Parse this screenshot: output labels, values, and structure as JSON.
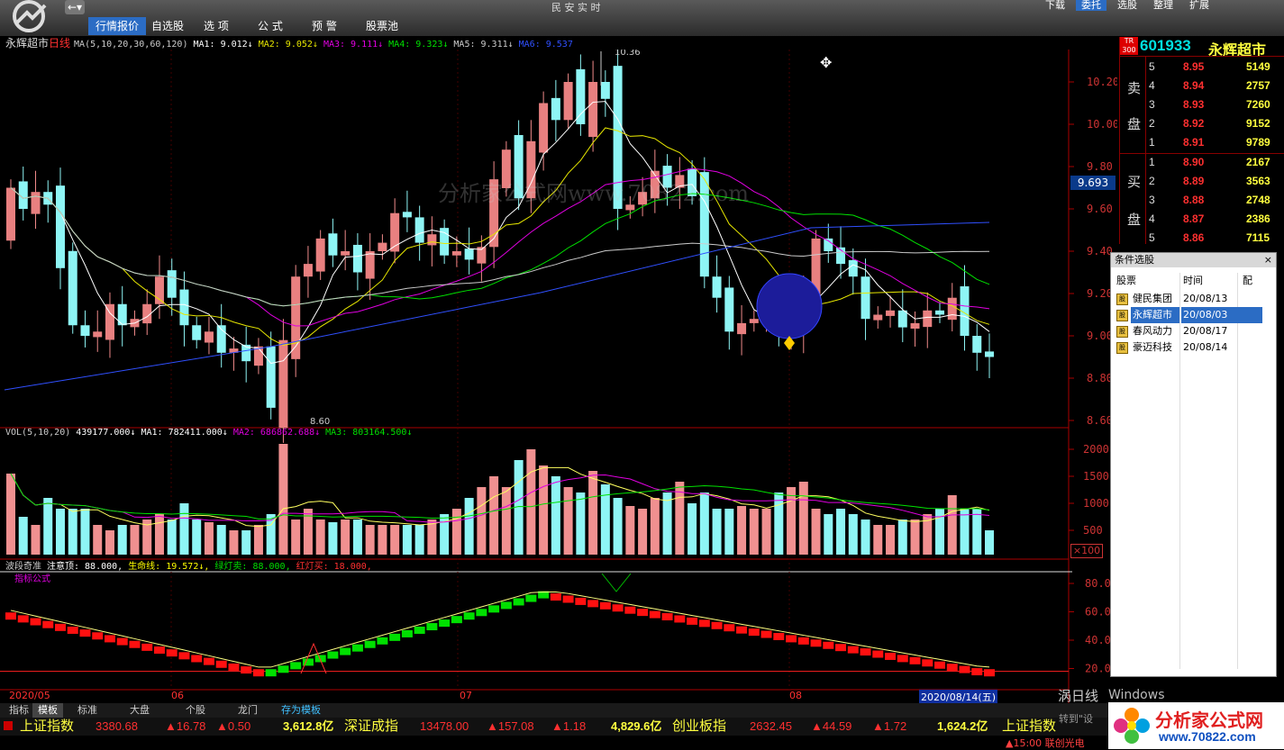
{
  "window": {
    "title": "民 安 实 时"
  },
  "toolbar": {
    "menus": [
      "行情报价",
      "自选股",
      "选 项",
      "公 式",
      "预 警",
      "股票池"
    ],
    "right_buttons": [
      "下载",
      "委托",
      "选股",
      "整理",
      "扩展"
    ]
  },
  "main_chart": {
    "stock_name": "永辉超市",
    "period": "日线",
    "ma_legend": [
      {
        "text": "MA(5,10,20,30,60,120)",
        "color": "#cccccc"
      },
      {
        "text": "MA1: 9.012↓",
        "color": "#ffffff"
      },
      {
        "text": "MA2: 9.052↓",
        "color": "#e6e600"
      },
      {
        "text": "MA3: 9.111↓",
        "color": "#e000e0"
      },
      {
        "text": "MA4: 9.323↓",
        "color": "#00e000"
      },
      {
        "text": "MA5: 9.311↓",
        "color": "#cccccc"
      },
      {
        "text": "MA6: 9.537",
        "color": "#3050ff"
      }
    ],
    "high_label": "10.36",
    "low_label": "8.60",
    "current_price_tag": "9.693",
    "watermark": "分析家公式网www.70822.com",
    "y_ticks": [
      "10.20",
      "10.00",
      "9.80",
      "9.60",
      "9.40",
      "9.20",
      "9.00",
      "8.80",
      "8.60"
    ],
    "x_labels": [
      "2020/05",
      "06",
      "07",
      "08"
    ],
    "date_tag": "2020/08/14",
    "weekday_tag": "五"
  },
  "volume_chart": {
    "legend": [
      {
        "text": "VOL(5,10,20)",
        "color": "#cccccc"
      },
      {
        "text": "439177.000↓",
        "color": "#ffffff"
      },
      {
        "text": "MA1: 782411.000↓",
        "color": "#ffffff"
      },
      {
        "text": "MA2: 686862.688↓",
        "color": "#e000e0"
      },
      {
        "text": "MA3: 803164.500↓",
        "color": "#00e000"
      }
    ],
    "y_ticks": [
      "2000",
      "1500",
      "1000",
      "500"
    ],
    "unit": "×100"
  },
  "indicator_chart": {
    "legend": [
      {
        "text": "波段奇准",
        "color": "#cccccc"
      },
      {
        "text": "注意顶: 88.000,",
        "color": "#ffffff"
      },
      {
        "text": "生命线: 19.572↓,",
        "color": "#ffff00"
      },
      {
        "text": "绿灯卖: 88.000,",
        "color": "#00e000"
      },
      {
        "text": "红灯买: 18.000,",
        "color": "#ff3030"
      }
    ],
    "sublabel": "指标公式",
    "y_ticks": [
      "80.0",
      "60.0",
      "40.0",
      "20.0"
    ]
  },
  "quote": {
    "badge": "TR 300",
    "code": "601933",
    "name": "永辉超市",
    "sell_label": [
      "卖",
      "盘"
    ],
    "buy_label": [
      "买",
      "盘"
    ],
    "sell": [
      {
        "level": "5",
        "price": "8.95",
        "vol": "5149"
      },
      {
        "level": "4",
        "price": "8.94",
        "vol": "2757"
      },
      {
        "level": "3",
        "price": "8.93",
        "vol": "7260"
      },
      {
        "level": "2",
        "price": "8.92",
        "vol": "9152"
      },
      {
        "level": "1",
        "price": "8.91",
        "vol": "9789"
      }
    ],
    "buy": [
      {
        "level": "1",
        "price": "8.90",
        "vol": "2167"
      },
      {
        "level": "2",
        "price": "8.89",
        "vol": "3563"
      },
      {
        "level": "3",
        "price": "8.88",
        "vol": "2748"
      },
      {
        "level": "4",
        "price": "8.87",
        "vol": "2386"
      },
      {
        "level": "5",
        "price": "8.86",
        "vol": "7115"
      }
    ]
  },
  "condition_panel": {
    "title": "条件选股",
    "headers": [
      "股票",
      "时间",
      "配"
    ],
    "rows": [
      {
        "name": "健民集团",
        "date": "20/08/13"
      },
      {
        "name": "永辉超市",
        "date": "20/08/03"
      },
      {
        "name": "春风动力",
        "date": "20/08/17"
      },
      {
        "name": "豪迈科技",
        "date": "20/08/14"
      }
    ],
    "selected_index": 1
  },
  "bottom_tabs": [
    "指标",
    "模板",
    "标准",
    "大盘",
    "个股",
    "龙门",
    "存为模板"
  ],
  "ticker": [
    {
      "name": "上证指数",
      "value": "3380.68",
      "change": "▲16.78",
      "pct": "▲0.50",
      "amount": "3,612.8亿"
    },
    {
      "name": "深证成指",
      "value": "13478.00",
      "change": "▲157.08",
      "pct": "▲1.18",
      "amount": "4,829.6亿"
    },
    {
      "name": "创业板指",
      "value": "2632.45",
      "change": "▲44.59",
      "pct": "▲1.72",
      "amount": "1,624.2亿"
    }
  ],
  "ticker_tail": "上证指数",
  "status": {
    "left": "涡日线",
    "right": "Windows",
    "activate": "转到\"设",
    "time_line": "▲15:00 联创光电"
  },
  "brand": {
    "name": "分析家公式网",
    "url": "www.70822.com"
  }
}
